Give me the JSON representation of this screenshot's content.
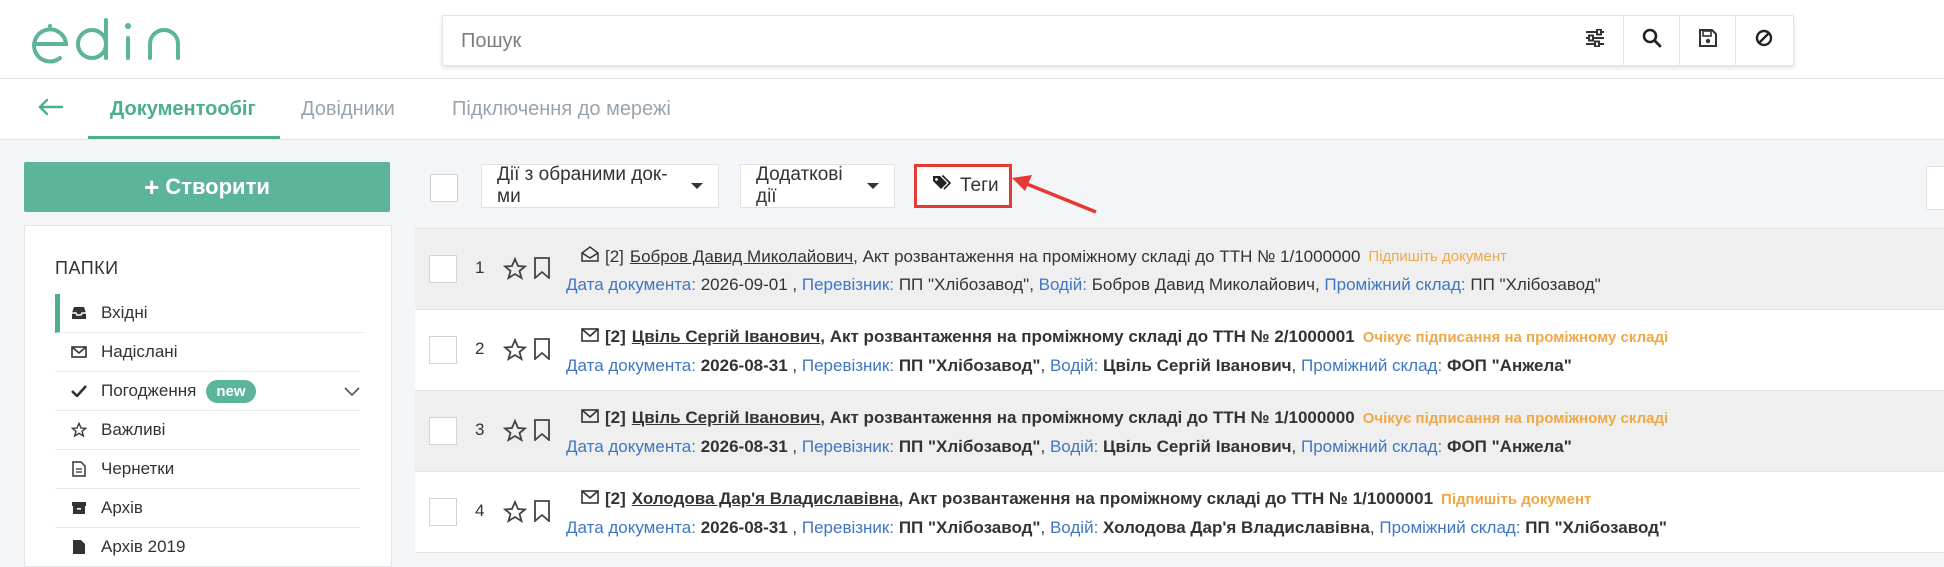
{
  "app": {
    "logo_text": "edin",
    "accent_color": "#4caf8e",
    "status_color": "#f0a847",
    "label_color": "#3f76c4"
  },
  "search": {
    "placeholder": "Пошук",
    "buttons": [
      "sliders-icon",
      "search-icon",
      "save-icon",
      "clear-icon"
    ]
  },
  "nav": {
    "back_icon": "arrow-left-icon",
    "tabs": [
      {
        "label": "Документообіг",
        "active": true
      },
      {
        "label": "Довідники",
        "active": false
      },
      {
        "label": "Підключення до мережі",
        "active": false
      }
    ]
  },
  "sidebar": {
    "create_label": "Створити",
    "folders_title": "ПАПКИ",
    "items": [
      {
        "label": "Вхідні",
        "icon": "inbox-icon",
        "active": true
      },
      {
        "label": "Надіслані",
        "icon": "envelope-icon"
      },
      {
        "label": "Погодження",
        "icon": "check-icon",
        "badge": "new"
      },
      {
        "label": "Важливі",
        "icon": "star-icon"
      },
      {
        "label": "Чернетки",
        "icon": "document-icon"
      },
      {
        "label": "Архів",
        "icon": "archive-icon"
      },
      {
        "label": "Архів 2019",
        "icon": "document-icon"
      }
    ]
  },
  "toolbar": {
    "actions_label": "Дії з обраними док-ми",
    "extra_label": "Додаткові дії",
    "tags_label": "Теги"
  },
  "documents": [
    {
      "num": "1",
      "count": "[2]",
      "sender": "Бобров Давид Миколайович",
      "title": ", Акт розвантаження на проміжному складі до ТТН № 1/1000000",
      "status": "Підпишіть документ",
      "date_label": "Дата документа:",
      "date": "2026-09-01",
      "carrier_label": "Перевізник:",
      "carrier": "ПП \"Хлібозавод\"",
      "driver_label": "Водій:",
      "driver": "Бобров Давид Миколайович",
      "warehouse_label": "Проміжний склад:",
      "warehouse": "ПП \"Хлібозавод\"",
      "read": true
    },
    {
      "num": "2",
      "count": "[2]",
      "sender": "Цвіль Сергій Іванович",
      "title": ", Акт розвантаження на проміжному складі до ТТН № 2/1000001",
      "status": "Очікує підписання на проміжному складі",
      "date_label": "Дата документа:",
      "date": "2026-08-31",
      "carrier_label": "Перевізник:",
      "carrier": "ПП \"Хлібозавод\"",
      "driver_label": "Водій:",
      "driver": "Цвіль Сергій Іванович",
      "warehouse_label": "Проміжний склад:",
      "warehouse": "ФОП \"Анжела\"",
      "read": false
    },
    {
      "num": "3",
      "count": "[2]",
      "sender": "Цвіль Сергій Іванович",
      "title": ", Акт розвантаження на проміжному складі до ТТН № 1/1000000",
      "status": "Очікує підписання на проміжному складі",
      "date_label": "Дата документа:",
      "date": "2026-08-31",
      "carrier_label": "Перевізник:",
      "carrier": "ПП \"Хлібозавод\"",
      "driver_label": "Водій:",
      "driver": "Цвіль Сергій Іванович",
      "warehouse_label": "Проміжний склад:",
      "warehouse": "ФОП \"Анжела\"",
      "read": false
    },
    {
      "num": "4",
      "count": "[2]",
      "sender": "Холодова Дар'я Владиславівна",
      "title": ", Акт розвантаження на проміжному складі до ТТН № 1/1000001",
      "status": "Підпишіть документ",
      "date_label": "Дата документа:",
      "date": "2026-08-31",
      "carrier_label": "Перевізник:",
      "carrier": "ПП \"Хлібозавод\"",
      "driver_label": "Водій:",
      "driver": "Холодова Дар'я Владиславівна",
      "warehouse_label": "Проміжний склад:",
      "warehouse": "ПП \"Хлібозавод\"",
      "read": false
    }
  ]
}
